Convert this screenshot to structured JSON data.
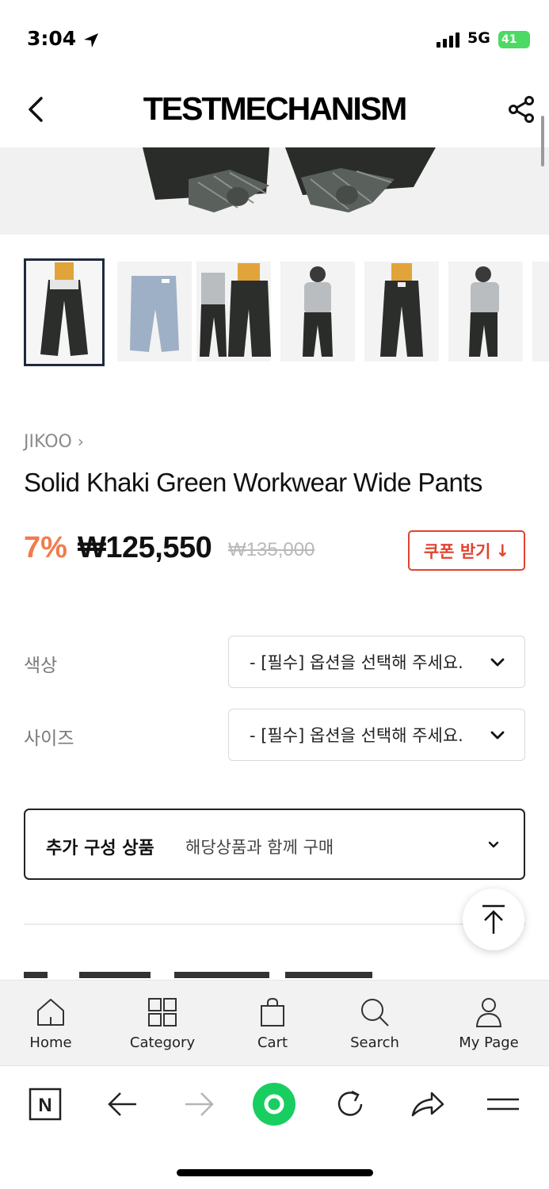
{
  "status_bar": {
    "time": "3:04",
    "network": "5G",
    "battery": "41"
  },
  "header": {
    "title": "TESTMECHANISM"
  },
  "product": {
    "brand": "JIKOO",
    "name": "Solid Khaki Green Workwear Wide Pants",
    "discount": "7%",
    "price": "₩125,550",
    "original_price": "₩135,000",
    "coupon_label": "쿠폰 받기",
    "coupon_icon": "↓"
  },
  "options": [
    {
      "label": "색상",
      "placeholder": "- [필수] 옵션을 선택해 주세요."
    },
    {
      "label": "사이즈",
      "placeholder": "- [필수] 옵션을 선택해 주세요."
    }
  ],
  "addon": {
    "title": "추가 구성 상품",
    "subtitle": "해당상품과 함께 구매"
  },
  "tabbar": [
    {
      "label": "Home",
      "icon": "home-icon"
    },
    {
      "label": "Category",
      "icon": "grid-icon"
    },
    {
      "label": "Cart",
      "icon": "bag-icon"
    },
    {
      "label": "Search",
      "icon": "search-icon"
    },
    {
      "label": "My Page",
      "icon": "person-icon"
    }
  ],
  "browser_toolbar": {
    "items": [
      "naver-icon",
      "back-arrow-icon",
      "forward-arrow-icon",
      "green-dot-icon",
      "reload-icon",
      "share-arrow-icon",
      "menu-icon"
    ]
  },
  "colors": {
    "accent_orange": "#f07c4d",
    "coupon_red": "#e0432f",
    "selected_border": "#1e2a3e",
    "green": "#19ce60"
  }
}
